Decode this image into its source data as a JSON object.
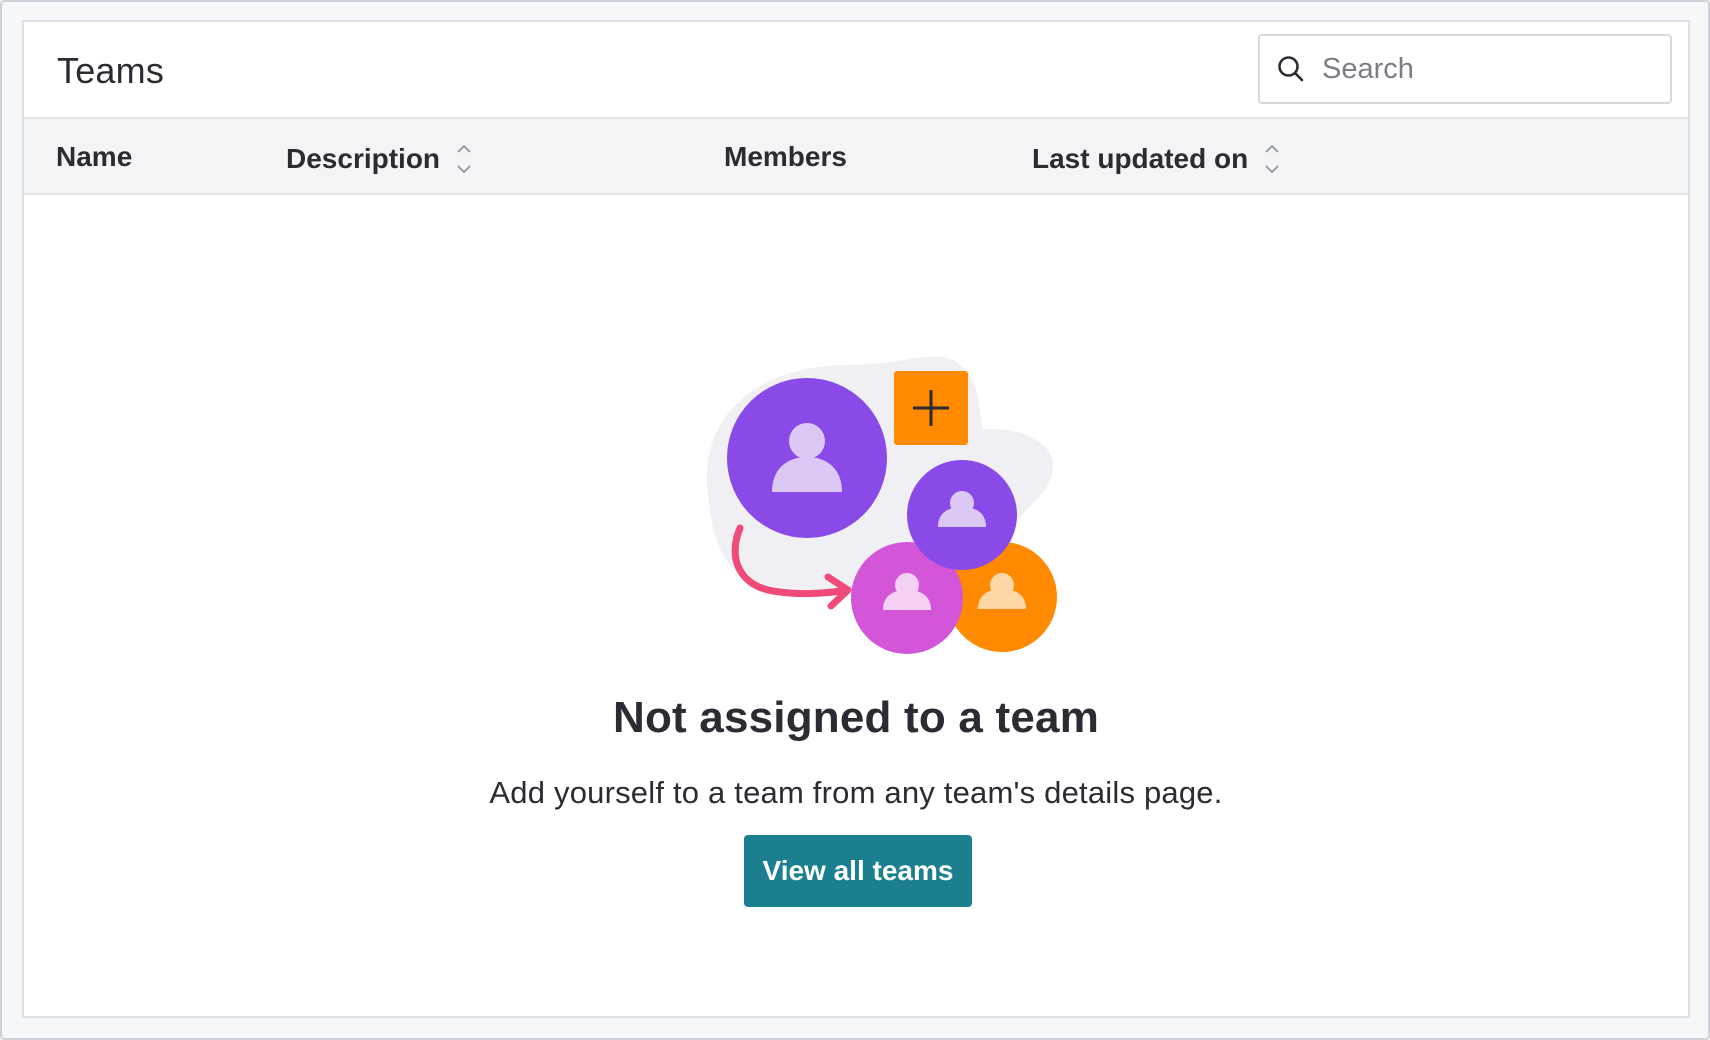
{
  "panel": {
    "title": "Teams"
  },
  "search": {
    "placeholder": "Search",
    "value": ""
  },
  "table": {
    "columns": [
      {
        "label": "Name",
        "sortable": false
      },
      {
        "label": "Description",
        "sortable": true
      },
      {
        "label": "Members",
        "sortable": false
      },
      {
        "label": "Last updated on",
        "sortable": true
      }
    ],
    "rows": []
  },
  "empty_state": {
    "title": "Not assigned to a team",
    "message": "Add yourself to a team from any team's details page.",
    "button_label": "View all teams",
    "illustration_icons": [
      "user-avatar-icon",
      "plus-icon",
      "arrow-icon"
    ]
  },
  "colors": {
    "primary_button": "#1c7f8f",
    "avatar_purple": "#8a4ae8",
    "avatar_magenta": "#d456d8",
    "avatar_orange": "#ff8a00",
    "arrow_pink": "#ef4a78"
  }
}
